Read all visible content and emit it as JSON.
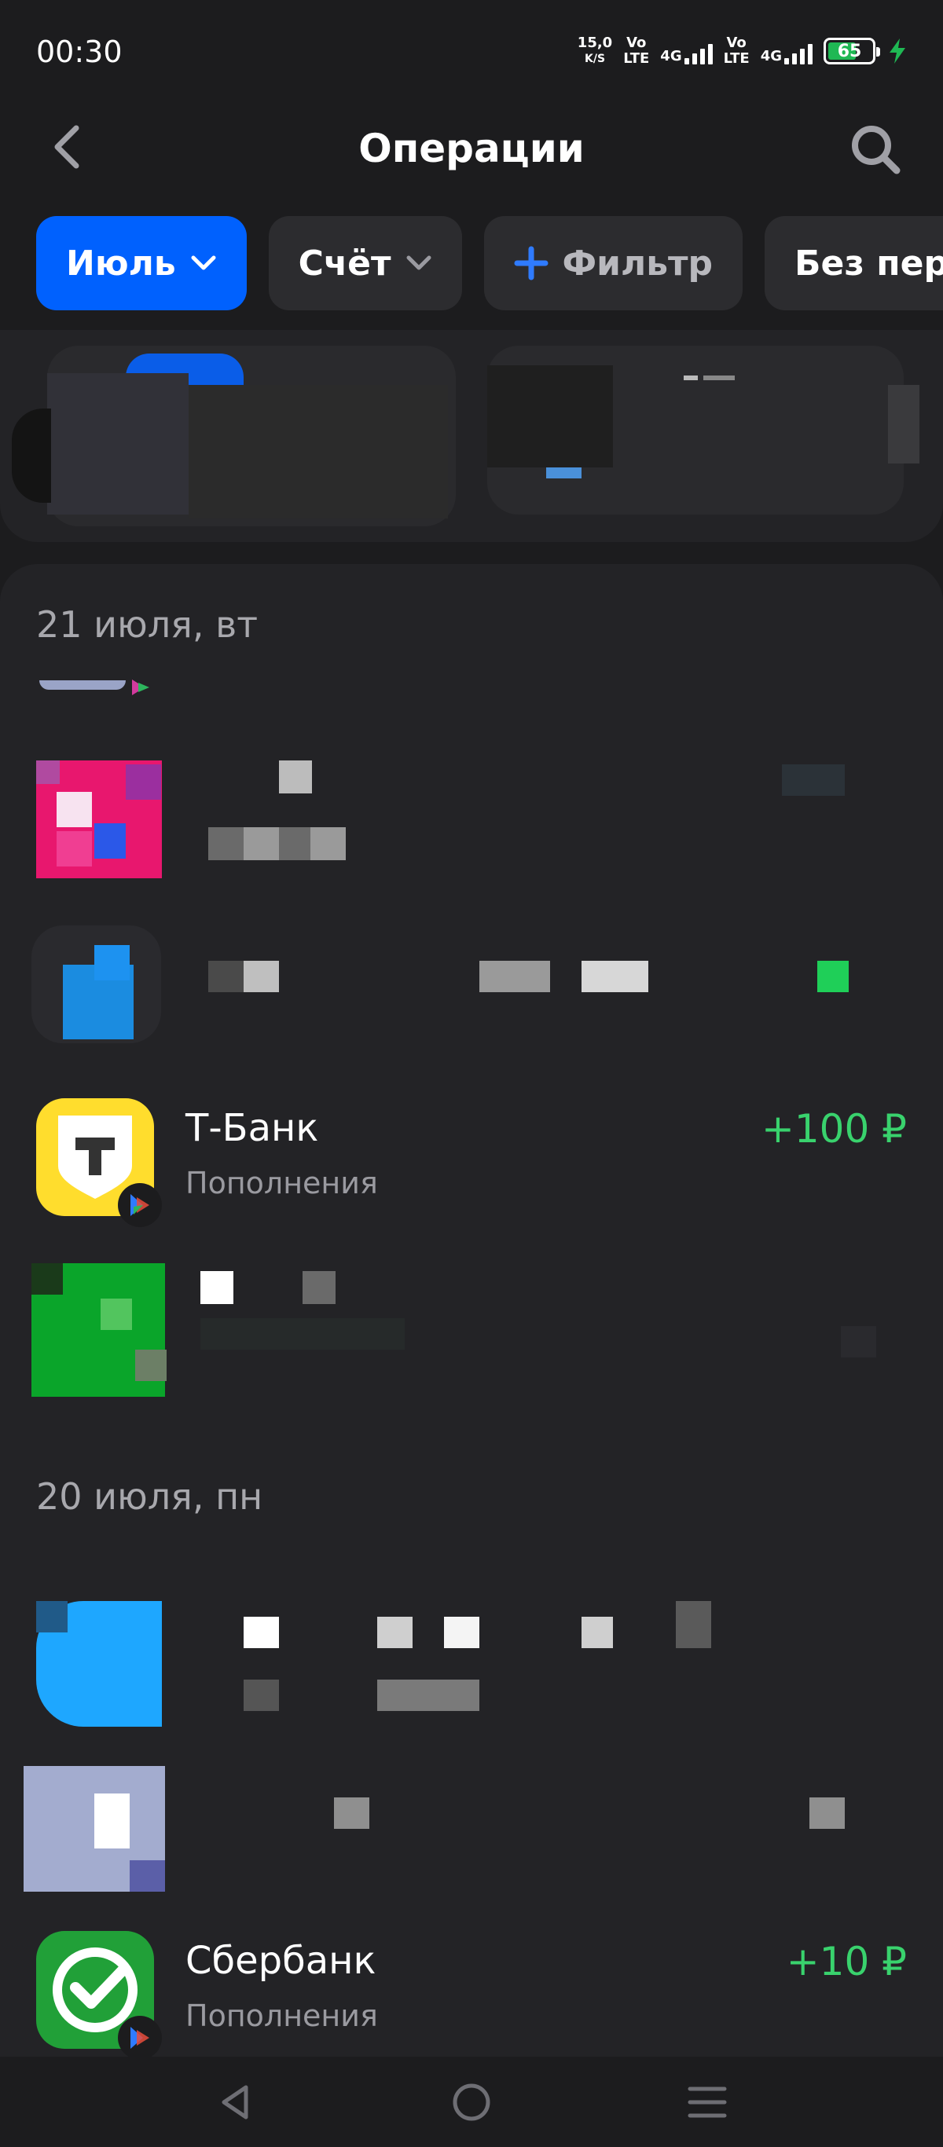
{
  "status_bar": {
    "time": "00:30",
    "net_speed_value": "15,0",
    "net_speed_unit": "K/S",
    "sim1_tag_top": "Vo",
    "sim1_tag_bottom": "LTE",
    "sim1_net": "4G",
    "sim2_tag_top": "Vo",
    "sim2_tag_bottom": "LTE",
    "sim2_net": "4G",
    "battery": "65",
    "battery_fill_percent": 65,
    "icons": [
      "signal-icon",
      "battery-icon",
      "charging-bolt-icon"
    ]
  },
  "header": {
    "title": "Операции",
    "back_icon": "chevron-left-icon",
    "search_icon": "search-icon"
  },
  "filters": {
    "month_label": "Июль",
    "account_label": "Счёт",
    "filter_label": "Фильтр",
    "no_transfers_label": "Без пер"
  },
  "sections": [
    {
      "date": "21 июля, вт",
      "visible_operations": [
        {
          "name": "Т-Банк",
          "category": "Пополнения",
          "amount": "+100 ₽",
          "logo": "tbank-logo-icon"
        }
      ]
    },
    {
      "date": "20 июля, пн",
      "visible_operations": [
        {
          "name": "Сбербанк",
          "category": "Пополнения",
          "amount": "+10 ₽",
          "logo": "sberbank-logo-icon"
        }
      ]
    }
  ],
  "colors": {
    "background": "#1c1c1e",
    "card": "#232326",
    "accent": "#0061fe",
    "income": "#39d26d",
    "tbank_yellow": "#ffdd2d",
    "sber_green": "#21a038"
  },
  "system_nav": {
    "icons": [
      "back-triangle-icon",
      "home-circle-icon",
      "menu-lines-icon"
    ]
  }
}
